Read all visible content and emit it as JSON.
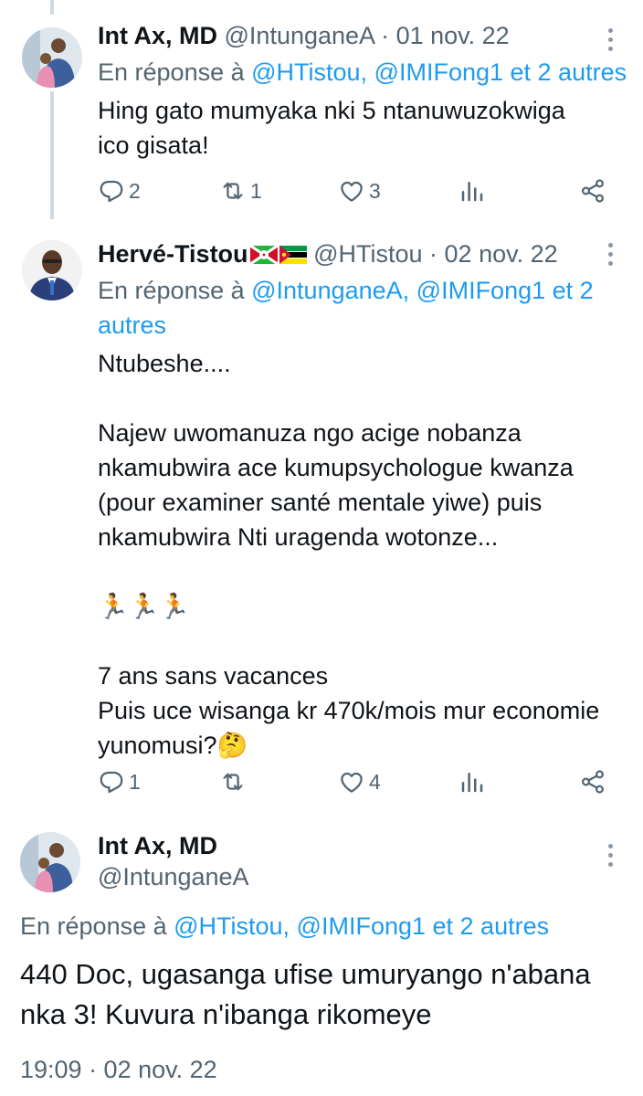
{
  "tweets": [
    {
      "name": "Int Ax, MD",
      "handle": "@IntunganeA",
      "dot": "·",
      "date": "01 nov. 22",
      "reply_prefix": "En réponse à ",
      "reply_mentions": "@HTistou, @IMIFong1 et 2 autres",
      "text": "Hing gato mumyaka nki 5 ntanuwuzokwiga\nico gisata!",
      "replies": "2",
      "retweets": "1",
      "likes": "3"
    },
    {
      "name": "Hervé-Tistou",
      "handle": "@HTistou",
      "dot": "·",
      "date": "02 nov. 22",
      "reply_prefix": "En réponse à ",
      "reply_mentions_line1": "@IntunganeA, @IMIFong1 et 2",
      "reply_mentions_line2": "autres",
      "text": "Ntubeshe....\n\nNajew uwomanuza ngo acige nobanza\nnkamubwira ace kumupsychologue kwanza\n(pour examiner santé mentale yiwe) puis\nnkamubwira Nti uragenda wotonze...\n\n🏃🏃🏃\n\n7 ans sans vacances\nPuis uce wisanga kr 470k/mois mur economie\nyunomusi?🤔",
      "replies": "1",
      "retweets": "",
      "likes": "4"
    },
    {
      "name": "Int Ax, MD",
      "handle": "@IntunganeA",
      "reply_prefix": "En réponse à ",
      "reply_mentions": "@HTistou, @IMIFong1 et 2 autres",
      "text": "440 Doc, ugasanga ufise umuryango n'abana\nnka 3! Kuvura n'ibanga rikomeye",
      "timestamp": "19:09 · 02 nov. 22"
    }
  ],
  "icons": {
    "reply": "reply-icon",
    "retweet": "retweet-icon",
    "like": "like-icon",
    "views": "views-icon",
    "share": "share-icon",
    "more": "more-icon"
  },
  "colors": {
    "text": "#0f1419",
    "secondary": "#536471",
    "link": "#1d9bf0",
    "thread_line": "#cfd9de"
  }
}
